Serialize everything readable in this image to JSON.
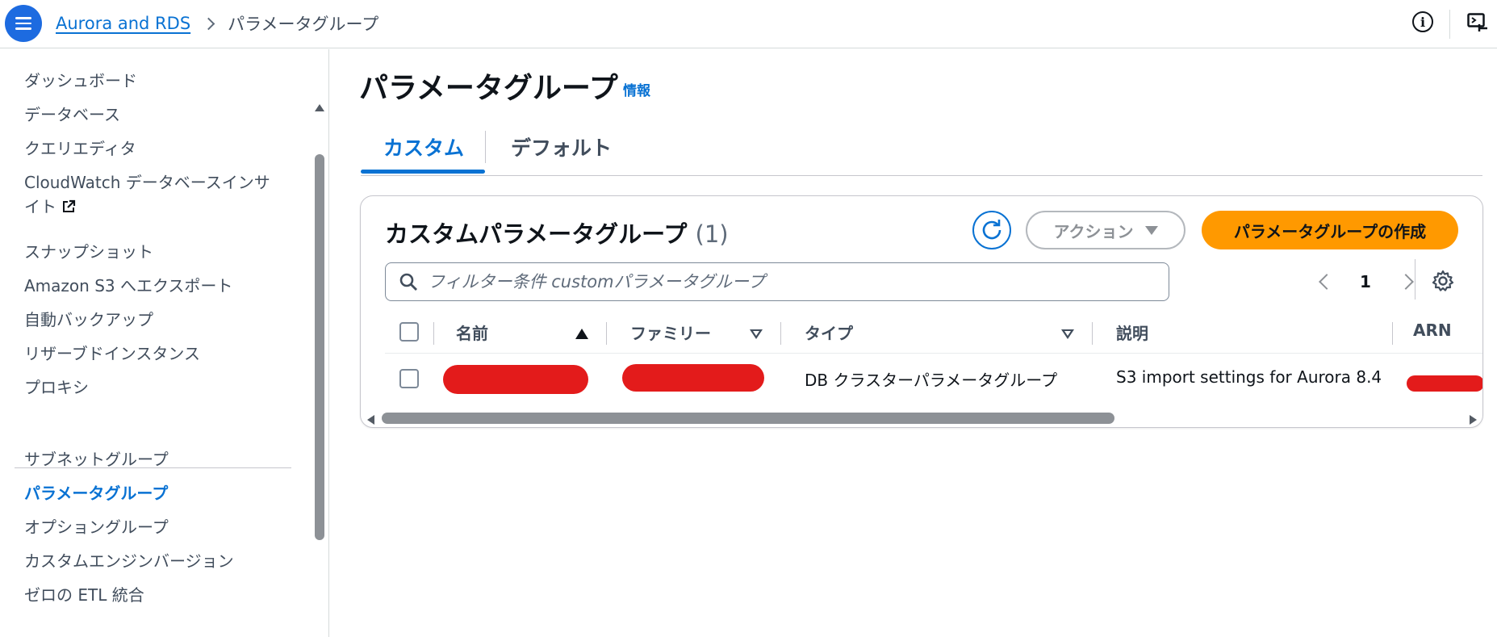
{
  "topbar": {
    "breadcrumb_root": "Aurora and RDS",
    "breadcrumb_current": "パラメータグループ",
    "info_icon": "info-icon",
    "cloudshell_icon": "cloudshell-icon"
  },
  "sidebar": {
    "items_top": [
      {
        "label": "ダッシュボード"
      },
      {
        "label": "データベース"
      },
      {
        "label": "クエリエディタ"
      },
      {
        "label_line1": "CloudWatch データベースインサ",
        "label_line2": "イト"
      },
      {
        "label": "スナップショット"
      },
      {
        "label": "Amazon S3 へエクスポート"
      },
      {
        "label": "自動バックアップ"
      },
      {
        "label": "リザーブドインスタンス"
      },
      {
        "label": "プロキシ"
      }
    ],
    "items_bottom": [
      {
        "label": "サブネットグループ"
      },
      {
        "label": "パラメータグループ",
        "active": true
      },
      {
        "label": "オプショングループ"
      },
      {
        "label": "カスタムエンジンバージョン"
      },
      {
        "label": "ゼロの ETL 統合"
      }
    ]
  },
  "main": {
    "title": "パラメータグループ",
    "info_link": "情報",
    "tabs": [
      {
        "label": "カスタム",
        "selected": true
      },
      {
        "label": "デフォルト",
        "selected": false
      }
    ],
    "card": {
      "title": "カスタムパラメータグループ",
      "count": "(1)",
      "action_label": "アクション",
      "create_label": "パラメータグループの作成",
      "search_placeholder": "フィルター条件 customパラメータグループ",
      "page_number": "1",
      "columns": [
        "名前",
        "ファミリー",
        "タイプ",
        "説明",
        "ARN"
      ],
      "rows": [
        {
          "type": "DB クラスターパラメータグループ",
          "description": "S3 import settings for Aurora 8.4"
        }
      ]
    }
  },
  "colors": {
    "primary_blue": "#0972d3",
    "create_orange": "#ff9900",
    "redaction_red": "#e31b1b"
  }
}
